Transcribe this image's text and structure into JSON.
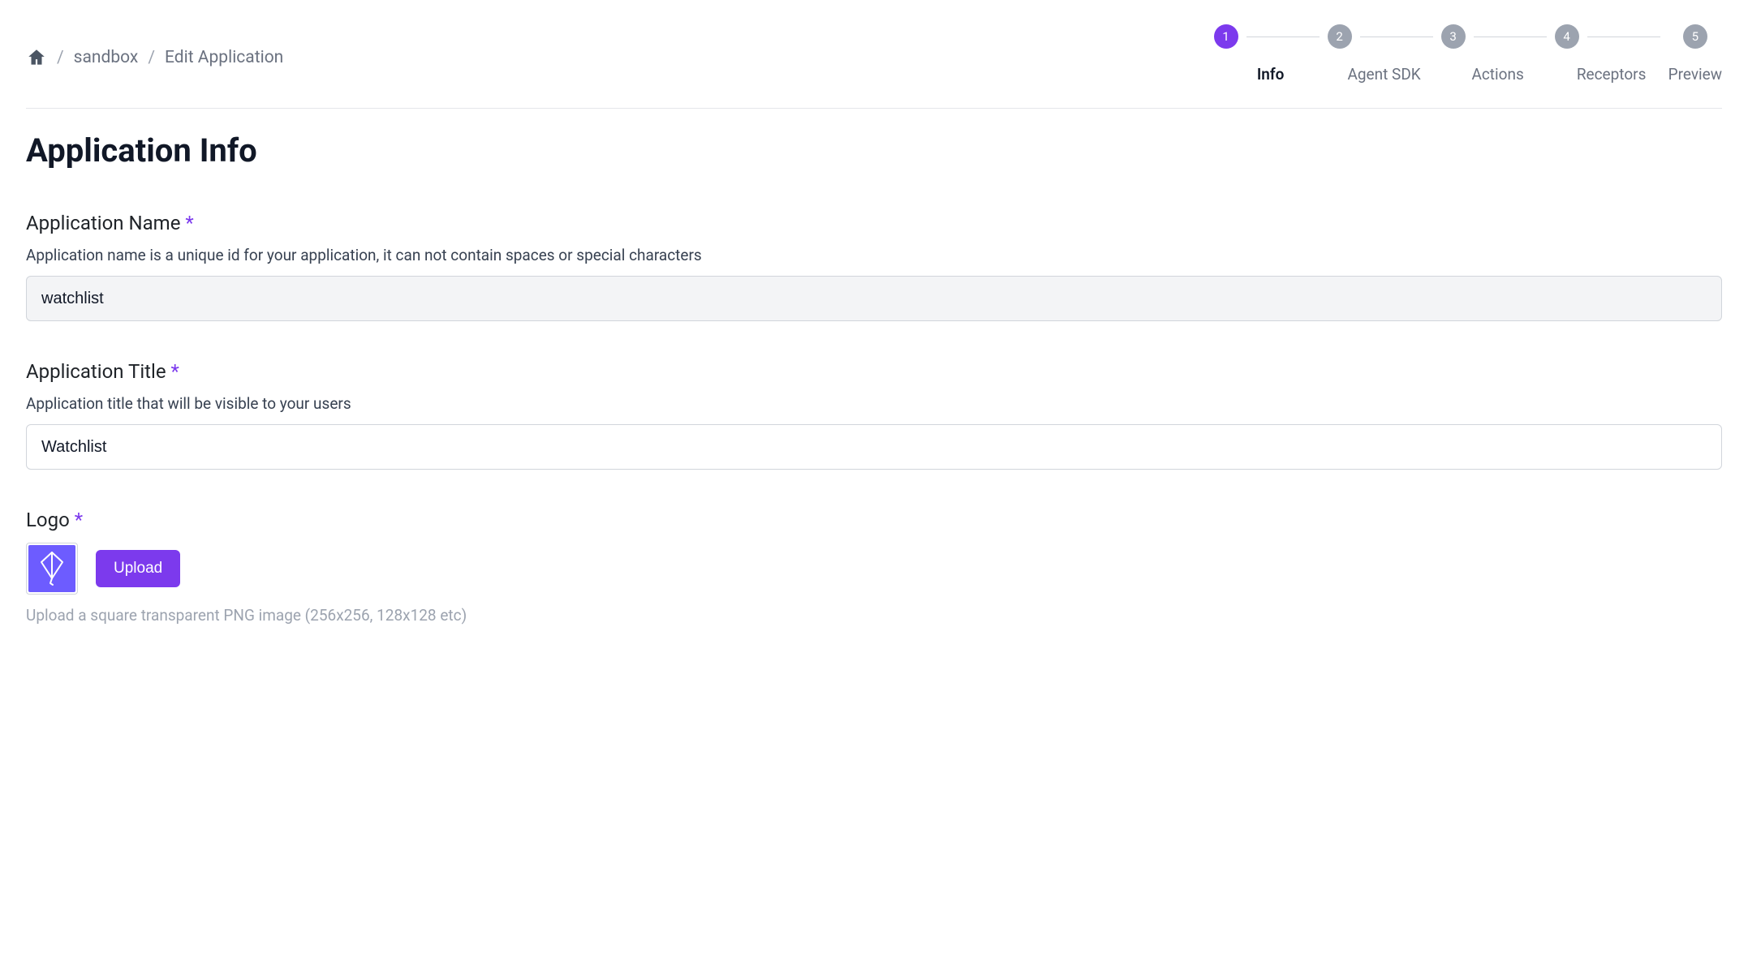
{
  "breadcrumb": {
    "sandbox": "sandbox",
    "current": "Edit Application"
  },
  "stepper": {
    "steps": [
      {
        "num": "1",
        "label": "Info",
        "active": true
      },
      {
        "num": "2",
        "label": "Agent SDK",
        "active": false
      },
      {
        "num": "3",
        "label": "Actions",
        "active": false
      },
      {
        "num": "4",
        "label": "Receptors",
        "active": false
      },
      {
        "num": "5",
        "label": "Preview",
        "active": false
      }
    ]
  },
  "page": {
    "title": "Application Info"
  },
  "fields": {
    "name": {
      "label": "Application Name",
      "required_marker": "*",
      "help": "Application name is a unique id for your application, it can not contain spaces or special characters",
      "value": "watchlist"
    },
    "title": {
      "label": "Application Title",
      "required_marker": "*",
      "help": "Application title that will be visible to your users",
      "value": "Watchlist"
    },
    "logo": {
      "label": "Logo",
      "required_marker": "*",
      "upload_button": "Upload",
      "hint": "Upload a square transparent PNG image (256x256, 128x128 etc)"
    }
  }
}
